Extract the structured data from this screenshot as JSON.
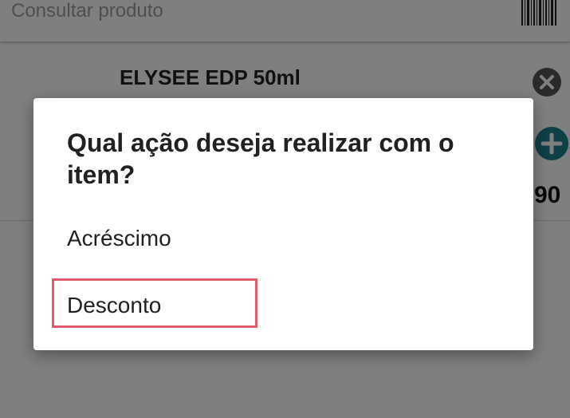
{
  "search": {
    "placeholder": "Consultar produto",
    "scan_icon": "barcode-icon"
  },
  "product": {
    "name": "ELYSEE EDP 50ml",
    "price_visible_fragment": "90",
    "remove_icon": "close-circle-icon",
    "add_icon": "plus-circle-icon"
  },
  "dialog": {
    "title": "Qual ação deseja realizar com o item?",
    "options": [
      {
        "label": "Acréscimo"
      },
      {
        "label": "Desconto",
        "highlighted": true
      }
    ]
  },
  "colors": {
    "accent_teal": "#1e7f8f",
    "highlight_red": "#e35b6a",
    "remove_icon_gray": "#555555"
  }
}
